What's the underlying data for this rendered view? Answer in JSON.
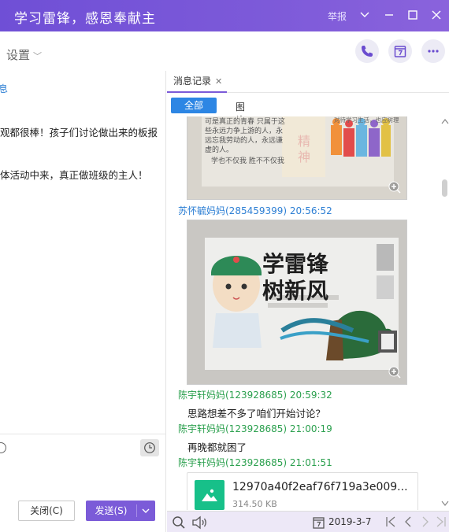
{
  "window": {
    "title": "学习雷锋，感恩奉献主",
    "report_label": "举报"
  },
  "toolbar": {
    "settings_label": "设置",
    "phone_icon": "phone-icon",
    "calendar_icon": "calendar-7-icon",
    "more_icon": "more-icon"
  },
  "left_panel": {
    "fragment_top": "息",
    "line1": "观都很棒！孩子们讨论做出来的板报",
    "line2": "体活动中来，真正做班级的主人！",
    "close_label": "关闭(C)",
    "send_label": "发送(S)"
  },
  "history": {
    "tab_label": "消息记录",
    "filter_all": "全部",
    "filter_images": "图片",
    "messages": [
      {
        "sender": "苏怀毓妈妈(285459399) 20:56:52",
        "type": "image",
        "caption": "学雷锋树新风"
      },
      {
        "sender": "陈宇轩妈妈(123928685) 20:59:32",
        "text": "思路想差不多了咱们开始讨论？"
      },
      {
        "sender": "陈宇轩妈妈(123928685) 21:00:19",
        "text": "再晚都就困了"
      },
      {
        "sender": "陈宇轩妈妈(123928685) 21:01:51",
        "type": "file"
      }
    ],
    "image1_text": {
      "line_a": "可是真正的青春  只属于这",
      "line_b": "些永远力争上游的人，永",
      "line_c": "远忘我劳动的人，永远谦",
      "line_d": "虚的人。",
      "line_e": "学也不仅我 胜不不仅我",
      "side": "对待学习生活，也应树理"
    },
    "image2_title_a": "学雷锋",
    "image2_title_b": "树新风",
    "file": {
      "name": "12970a40f2eaf76f719a3e009...",
      "size": "314.50 KB"
    },
    "date": "2019-3-7"
  }
}
